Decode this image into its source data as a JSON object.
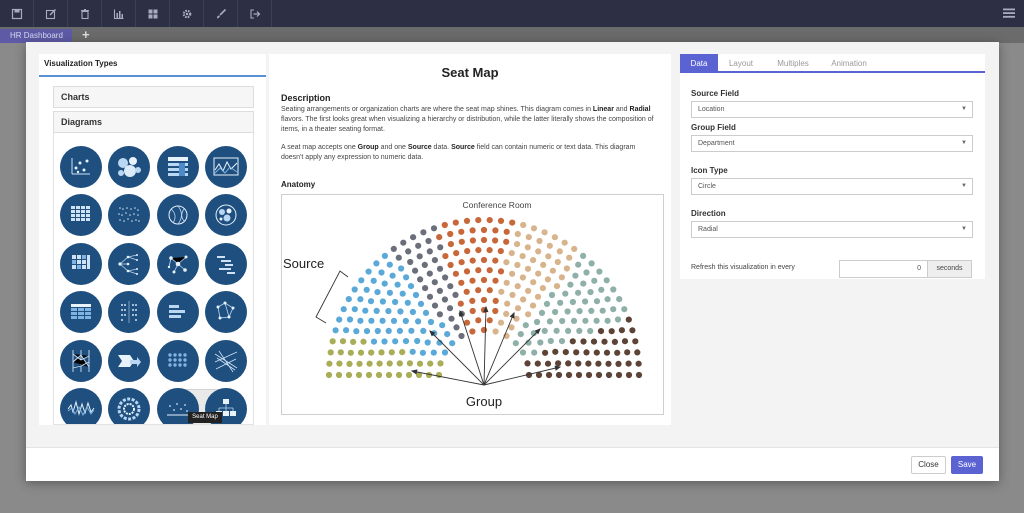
{
  "toolbar": {
    "icons": [
      "save-icon",
      "edit-icon",
      "delete-icon",
      "chart-icon",
      "grid-icon",
      "settings-icon",
      "brush-icon",
      "exit-icon",
      "menu-icon"
    ]
  },
  "dashboard_tab": {
    "label": "HR Dashboard",
    "add": "+"
  },
  "left_panel": {
    "title": "Visualization Types",
    "sections": [
      {
        "label": "Charts"
      },
      {
        "label": "Diagrams"
      }
    ],
    "tooltip": "Seat Map"
  },
  "main": {
    "title": "Seat Map",
    "description_heading": "Description",
    "description_p1_a": "Seating arrangements or organization charts are where the seat map shines. This diagram comes in ",
    "description_p1_b": "Linear",
    "description_p1_c": " and ",
    "description_p1_d": "Radial",
    "description_p1_e": " flavors. The first looks great when visualizing a hierarchy or distribution, while the latter literally shows the composition of items, in a theater seating format.",
    "description_p2_a": "A seat map accepts one ",
    "description_p2_b": "Group",
    "description_p2_c": " and one ",
    "description_p2_d": "Source",
    "description_p2_e": " data. ",
    "description_p2_f": "Source",
    "description_p2_g": " field can contain numeric or text data. This diagram doesn't apply any expression to numeric data.",
    "anatomy_heading": "Anatomy",
    "anatomy": {
      "room_label": "Conference Room",
      "source_label": "Source",
      "group_label": "Group"
    }
  },
  "settings": {
    "tabs": [
      "Data",
      "Layout",
      "Multiples",
      "Animation"
    ],
    "active_tab": "Data",
    "fields": [
      {
        "label": "Source Field",
        "value": "Location"
      },
      {
        "label": "Group Field",
        "value": "Department"
      },
      {
        "label": "Icon Type",
        "value": "Circle"
      },
      {
        "label": "Direction",
        "value": "Radial"
      }
    ],
    "refresh_label": "Refresh this visualization in every",
    "refresh_value": "0",
    "refresh_unit": "seconds"
  },
  "footer": {
    "close_label": "Close",
    "save_label": "Save"
  },
  "colors": {
    "toolbar": "#2d2f45",
    "accent": "#5b63d3",
    "icon_circle": "#1e4f7e",
    "seat_olive": "#a9ad57",
    "seat_blue": "#5aa9d8",
    "seat_gray": "#6b6f7a",
    "seat_orange": "#c8673a",
    "seat_tan": "#d8b48d",
    "seat_teal": "#8fb0a8",
    "seat_brown": "#5d4336"
  }
}
